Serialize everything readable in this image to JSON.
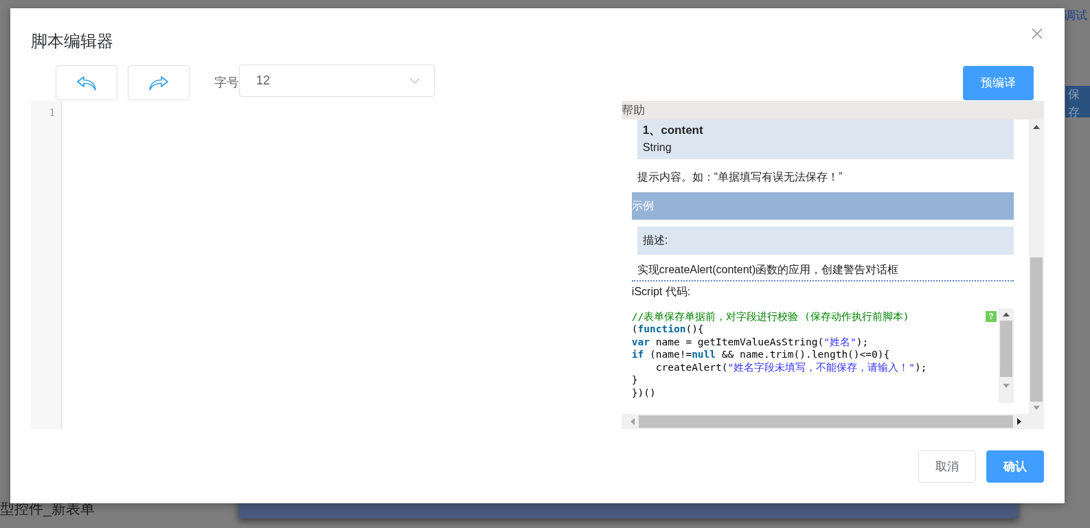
{
  "background": {
    "debug_link": "调试",
    "save_button": "保存",
    "sidebar_item": "型控件_新表单"
  },
  "dialog": {
    "title": "脚本编辑器",
    "toolbar": {
      "font_size_label": "字号",
      "font_size_value": "12",
      "precompile_button": "预编译"
    },
    "editor": {
      "line_numbers": [
        "1"
      ]
    },
    "help": {
      "title": "帮助",
      "param": {
        "name": "1、content",
        "type": "String"
      },
      "param_description": "提示内容。如：“单据填写有误无法保存！”",
      "example_heading": "示例",
      "description_label": "描述:",
      "description": "实现createAlert(content)函数的应用，创建警告对话框",
      "code_label": "iScript 代码:",
      "code_lines": [
        [
          {
            "text": "//表单保存单据前，对字段进行校验 (保存动作执行前脚本)",
            "kind": "comment"
          }
        ],
        [
          {
            "text": "(",
            "kind": "plain"
          },
          {
            "text": "function",
            "kind": "keyword"
          },
          {
            "text": "(){",
            "kind": "plain"
          }
        ],
        [
          {
            "text": "var",
            "kind": "keyword"
          },
          {
            "text": " name = getItemValueAsString(",
            "kind": "plain"
          },
          {
            "text": "\"姓名\"",
            "kind": "string"
          },
          {
            "text": ");",
            "kind": "plain"
          }
        ],
        [
          {
            "text": "if",
            "kind": "keyword"
          },
          {
            "text": " (name!=",
            "kind": "plain"
          },
          {
            "text": "null",
            "kind": "keyword"
          },
          {
            "text": " && name.trim().length()<=0){",
            "kind": "plain"
          }
        ],
        [
          {
            "text": "    createAlert(",
            "kind": "plain"
          },
          {
            "text": "\"姓名字段未填写，不能保存，请输入！\"",
            "kind": "string"
          },
          {
            "text": ");",
            "kind": "plain"
          }
        ],
        [
          {
            "text": "}",
            "kind": "plain"
          }
        ],
        [
          {
            "text": "})()",
            "kind": "plain"
          }
        ]
      ],
      "code_help_badge": "?"
    },
    "buttons": [
      {
        "label": "取消",
        "kind": "secondary"
      },
      {
        "label": "确认",
        "kind": "primary"
      }
    ]
  }
}
